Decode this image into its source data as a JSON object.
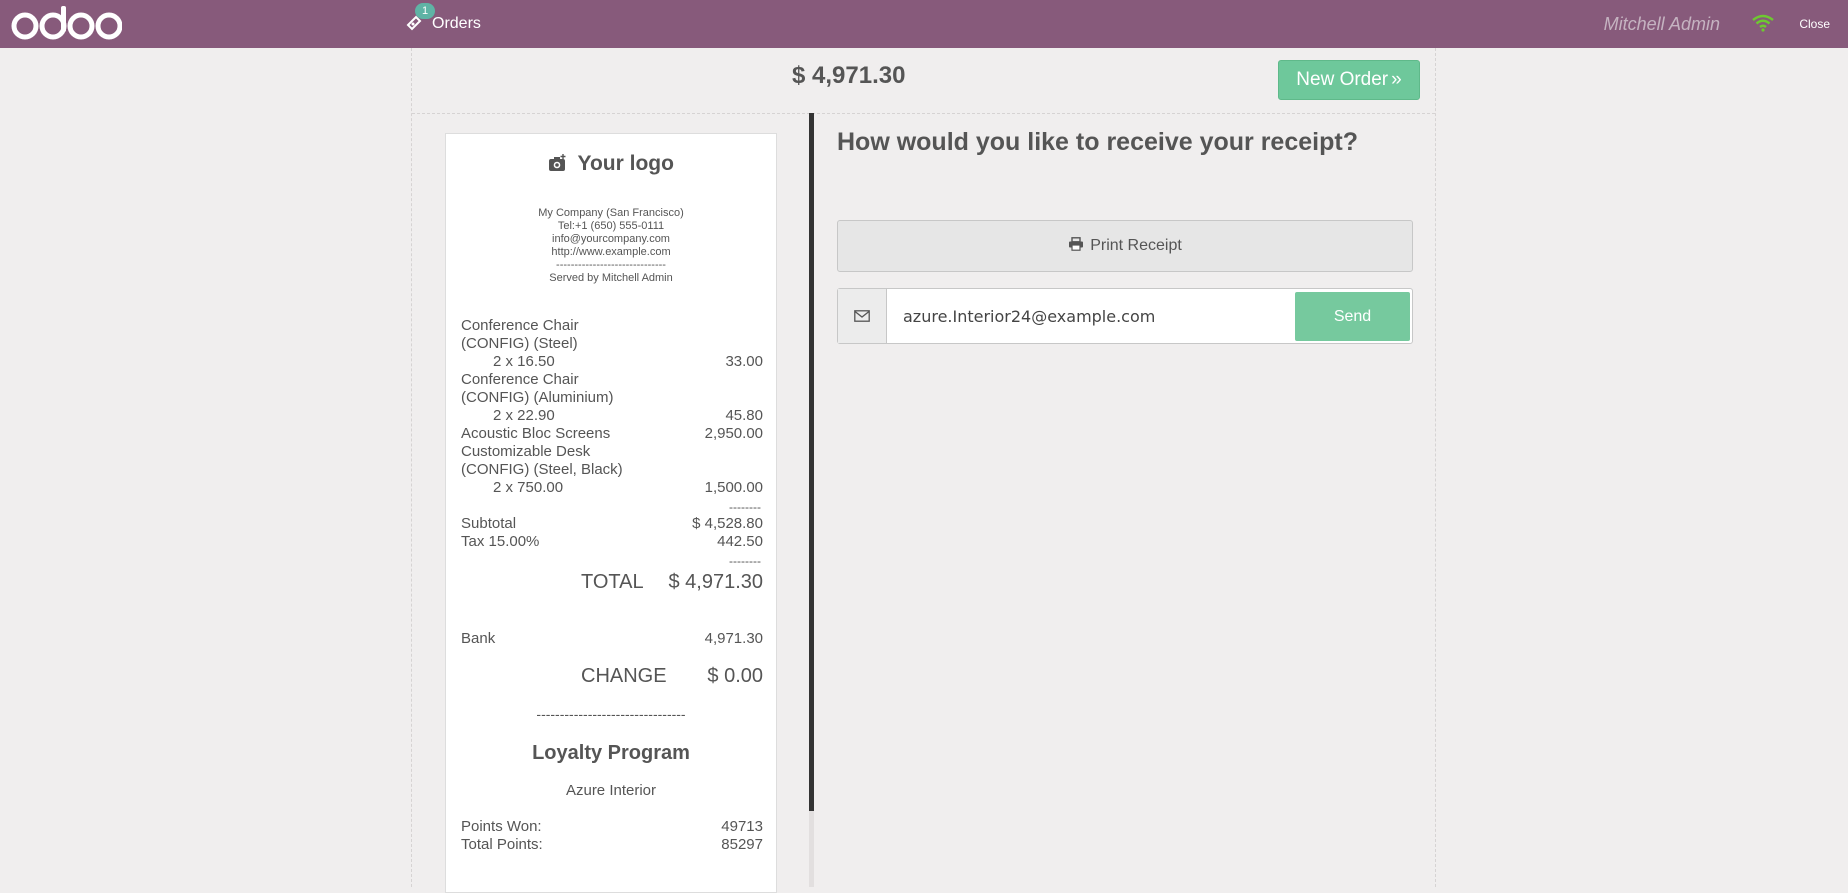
{
  "topbar": {
    "logo_text": "odoo",
    "orders_label": "Orders",
    "orders_badge": "1",
    "user_name": "Mitchell Admin",
    "close_label": "Close"
  },
  "header": {
    "amount": "$ 4,971.30",
    "new_order_label": "New Order"
  },
  "receipt": {
    "logo_text": "Your logo",
    "company_lines": [
      "My Company (San Francisco)",
      "Tel:+1 (650) 555-0111",
      "info@yourcompany.com",
      "http://www.example.com",
      "------------------------------",
      "Served by Mitchell Admin"
    ],
    "lines": [
      {
        "name1": "Conference Chair",
        "name2": "(CONFIG) (Steel)",
        "qty": "2 x 16.50",
        "amount": "33.00"
      },
      {
        "name1": "Conference Chair",
        "name2": "(CONFIG) (Aluminium)",
        "qty": "2 x 22.90",
        "amount": "45.80"
      },
      {
        "name1": "Acoustic Bloc Screens",
        "amount": "2,950.00"
      },
      {
        "name1": "Customizable Desk",
        "name2": "(CONFIG) (Steel, Black)",
        "qty": "2 x 750.00",
        "amount": "1,500.00"
      }
    ],
    "dash_short": "--------",
    "subtotal_label": "Subtotal",
    "subtotal_value": "$ 4,528.80",
    "tax_label": "Tax 15.00%",
    "tax_value": "442.50",
    "total_label": "TOTAL",
    "total_value": "$ 4,971.30",
    "payment_label": "Bank",
    "payment_value": "4,971.30",
    "change_label": "CHANGE",
    "change_value": "$ 0.00",
    "separator": "--------------------------------",
    "loyalty_title": "Loyalty Program",
    "loyalty_customer": "Azure Interior",
    "points_won_label": "Points Won:",
    "points_won_value": "49713",
    "total_points_label": "Total Points:",
    "total_points_value": "85297"
  },
  "right": {
    "question": "How would you like to receive your receipt?",
    "print_label": "Print Receipt",
    "email_value": "azure.Interior24@example.com",
    "send_label": "Send"
  },
  "colors": {
    "topbar": "#875a7b",
    "accent_green": "#6ec89b",
    "background": "#f0eeee"
  }
}
